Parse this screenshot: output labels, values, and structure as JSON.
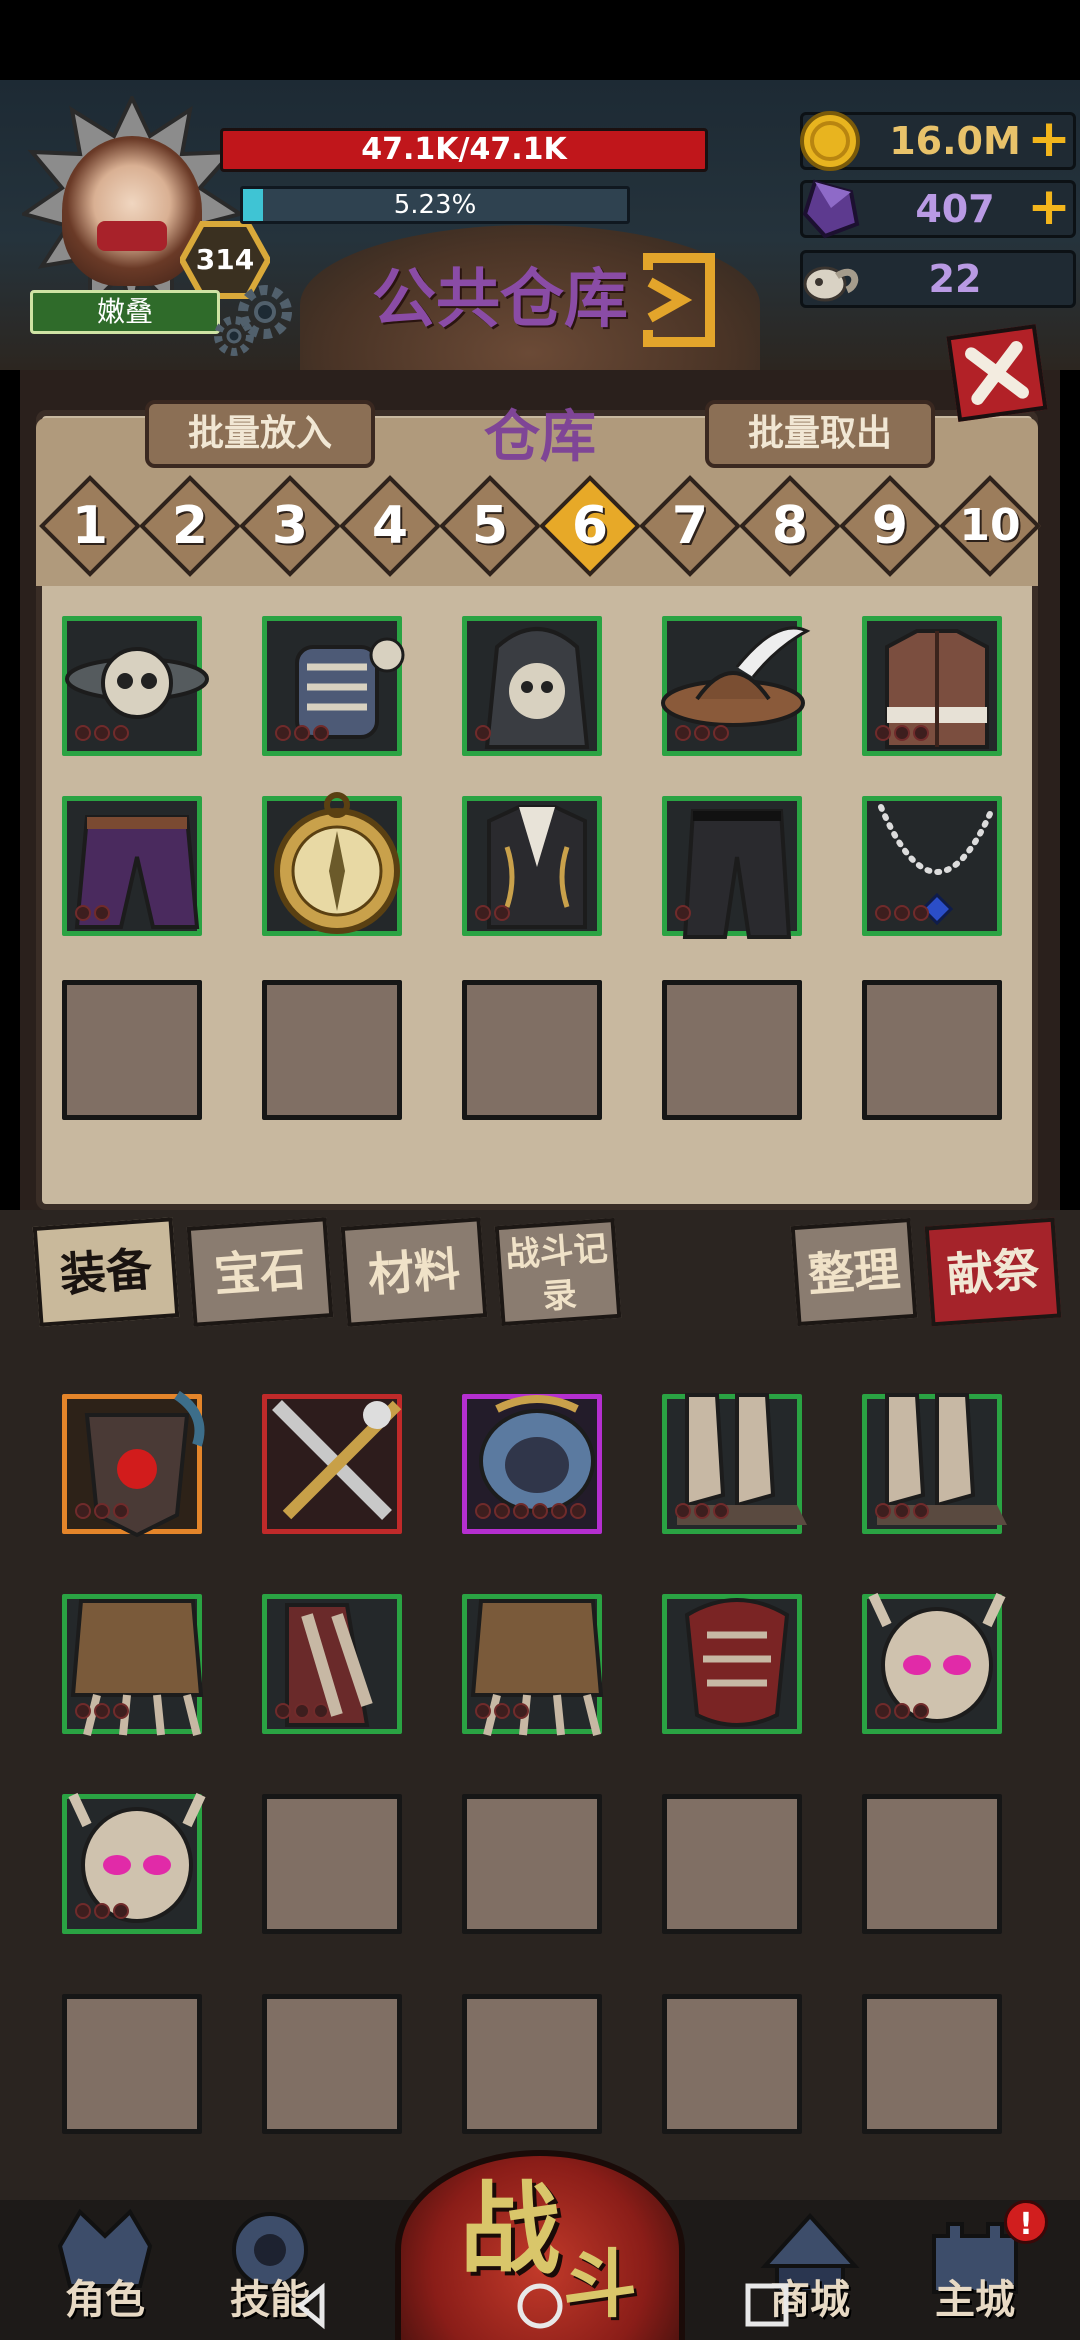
{
  "player": {
    "name": "嫩叠",
    "level": "314",
    "hp": "47.1K/47.1K",
    "xp_percent": "5.23%",
    "xp_fraction": 0.0523
  },
  "resources": [
    {
      "name": "gold",
      "value": "16.0M",
      "icon": "gold-coin-icon",
      "has_plus": true
    },
    {
      "name": "crystal",
      "value": "407",
      "icon": "purple-crystal-icon",
      "has_plus": true
    },
    {
      "name": "skull",
      "value": "22",
      "icon": "ram-skull-icon",
      "has_plus": false
    }
  ],
  "resource_plus": "+",
  "header": {
    "public_warehouse": "公共仓库"
  },
  "warehouse": {
    "title": "仓库",
    "batch_in": "批量放入",
    "batch_out": "批量取出",
    "pages": [
      "1",
      "2",
      "3",
      "4",
      "5",
      "6",
      "7",
      "8",
      "9",
      "10"
    ],
    "active_page": "6",
    "items": [
      {
        "name": "skull-hat-item",
        "rarity": "green",
        "stars": 3
      },
      {
        "name": "skeleton-armor-item",
        "rarity": "green",
        "stars": 3
      },
      {
        "name": "hooded-skull-item",
        "rarity": "green",
        "stars": 1
      },
      {
        "name": "feather-hat-item",
        "rarity": "green",
        "stars": 3
      },
      {
        "name": "leather-coat-item",
        "rarity": "green",
        "stars": 3
      },
      {
        "name": "purple-pants-item",
        "rarity": "green",
        "stars": 2
      },
      {
        "name": "compass-item",
        "rarity": "green",
        "stars": 0
      },
      {
        "name": "gold-coat-item",
        "rarity": "green",
        "stars": 2
      },
      {
        "name": "black-pants-item",
        "rarity": "green",
        "stars": 1
      },
      {
        "name": "pearl-necklace-item",
        "rarity": "green",
        "stars": 3
      }
    ],
    "empty_slots": 5
  },
  "categories": [
    {
      "label": "装备",
      "active": true
    },
    {
      "label": "宝石",
      "active": false
    },
    {
      "label": "材料",
      "active": false
    },
    {
      "label": "战斗记录",
      "active": false
    }
  ],
  "actions": {
    "sort": "整理",
    "sacrifice": "献祭"
  },
  "inventory": {
    "items": [
      {
        "name": "dragon-shield-item",
        "rarity": "orange",
        "stars": 3
      },
      {
        "name": "crossed-swords-item",
        "rarity": "red",
        "stars": 0
      },
      {
        "name": "ornate-shield-item",
        "rarity": "purple",
        "stars": 6
      },
      {
        "name": "bone-boots-item",
        "rarity": "green",
        "stars": 3
      },
      {
        "name": "bone-boots-item-2",
        "rarity": "green",
        "stars": 3
      },
      {
        "name": "bone-skirt-item",
        "rarity": "green",
        "stars": 3
      },
      {
        "name": "bone-legs-item",
        "rarity": "green",
        "stars": 3
      },
      {
        "name": "bone-skirt-item-2",
        "rarity": "green",
        "stars": 3
      },
      {
        "name": "red-bone-chest-item",
        "rarity": "green",
        "stars": 0
      },
      {
        "name": "horned-skull-item",
        "rarity": "green",
        "stars": 3
      },
      {
        "name": "horned-skull-item-2",
        "rarity": "green",
        "stars": 3
      }
    ],
    "empty_slots": 9
  },
  "bottom_nav": [
    {
      "label": "角色",
      "icon": "helmet-icon"
    },
    {
      "label": "技能",
      "icon": "skill-orb-icon"
    },
    {
      "label": "战",
      "icon": "battle-icon"
    },
    {
      "label": "斗",
      "icon": "battle-icon"
    },
    {
      "label": "商城",
      "icon": "shop-tent-icon"
    },
    {
      "label": "主城",
      "icon": "castle-icon"
    }
  ],
  "notification_badge": "!",
  "colors": {
    "hp": "#c0161b",
    "xp": "#3fc4d4",
    "active_page": "#e7a928",
    "rarity_green": "#2aa343",
    "rarity_red": "#c02a2a",
    "rarity_orange": "#e4852a",
    "rarity_purple": "#b52fd0"
  }
}
